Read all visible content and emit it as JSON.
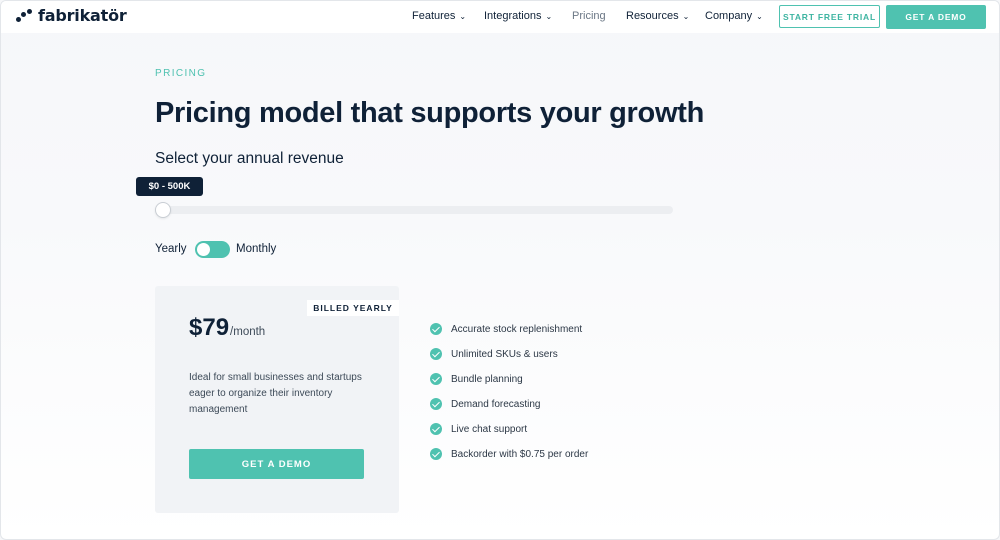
{
  "header": {
    "brand": "fabrikatör",
    "nav": [
      {
        "label": "Features",
        "has_dropdown": true
      },
      {
        "label": "Integrations",
        "has_dropdown": true
      },
      {
        "label": "Pricing",
        "has_dropdown": false
      },
      {
        "label": "Resources",
        "has_dropdown": true
      },
      {
        "label": "Company",
        "has_dropdown": true
      }
    ],
    "trial_label": "START FREE TRIAL",
    "demo_label": "GET A DEMO"
  },
  "hero": {
    "eyebrow": "PRICING",
    "title": "Pricing model that supports your growth",
    "subtitle": "Select your annual revenue"
  },
  "slider": {
    "value_label": "$0 - 500K",
    "position_fraction": 0
  },
  "billing_toggle": {
    "left_label": "Yearly",
    "right_label": "Monthly",
    "selected": "Yearly"
  },
  "plan": {
    "badge": "BILLED YEARLY",
    "price": "$79",
    "period": "/month",
    "description": "Ideal for small businesses and startups eager to organize their inventory management",
    "cta": "GET A DEMO"
  },
  "features": [
    "Accurate stock replenishment",
    "Unlimited SKUs & users",
    "Bundle planning",
    "Demand forecasting",
    "Live chat support",
    "Backorder with $0.75 per order"
  ],
  "colors": {
    "accent": "#4fc2b0",
    "navy": "#0f2137"
  },
  "icons": {
    "logo": "three-dots-logo-icon",
    "dropdown": "chevron-down-icon",
    "feature": "check-circle-icon"
  }
}
